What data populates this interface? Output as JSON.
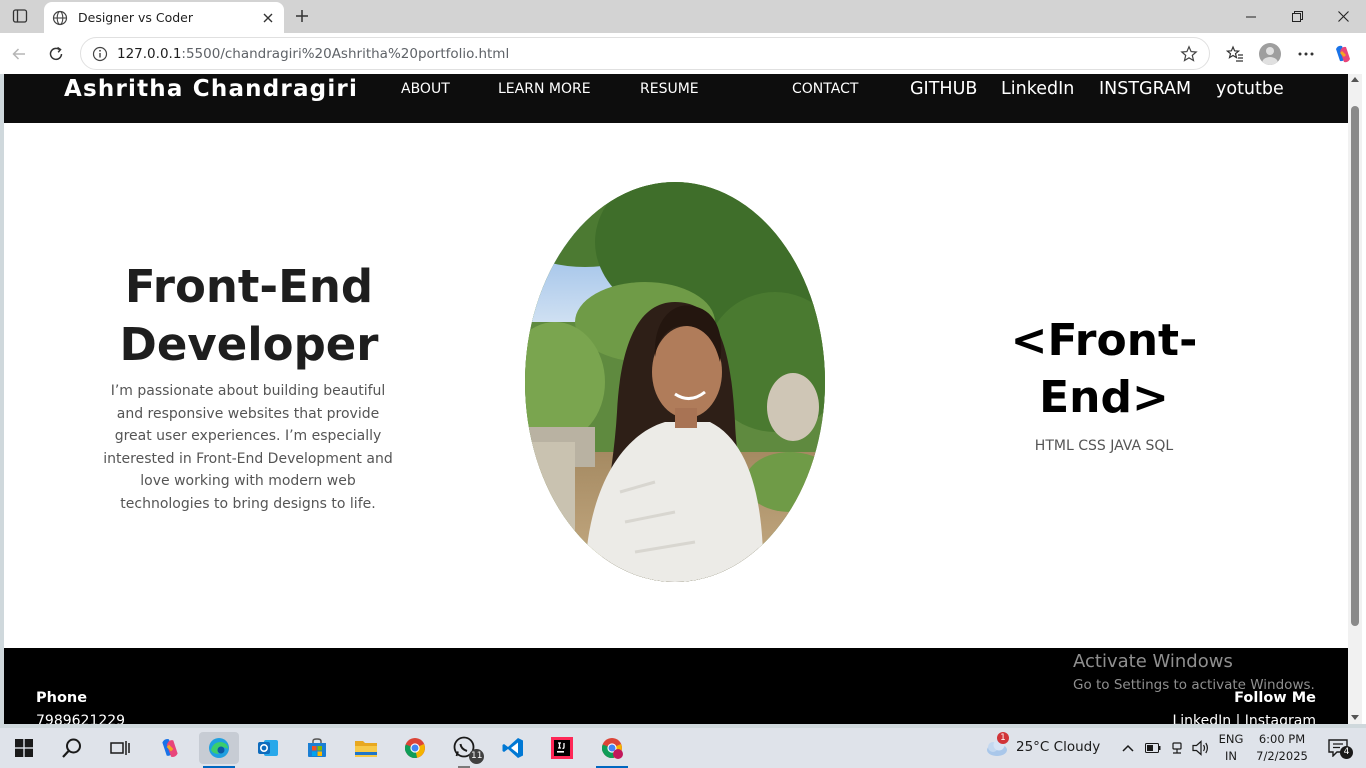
{
  "browser": {
    "tab_title": "Designer vs Coder",
    "url_host": "127.0.0.1",
    "url_path": ":5500/chandragiri%20Ashritha%20portfolio.html"
  },
  "site": {
    "brand": "Ashritha Chandragiri",
    "nav": [
      "ABOUT",
      "LEARN MORE",
      "RESUME",
      "CONTACT"
    ],
    "social_nav": [
      "GITHUB",
      "LinkedIn",
      "INSTGRAM",
      "yotutbe"
    ],
    "hero_title_line1": "Front-End",
    "hero_title_line2": "Developer",
    "hero_text": "I’m passionate about building beautiful and responsive websites that provide great user experiences. I’m especially interested in Front-End Development and love working with modern web technologies to bring designs to life.",
    "code_title_line1": "<Front-",
    "code_title_line2": "End>",
    "skills": "HTML CSS JAVA SQL"
  },
  "footer": {
    "phone_label": "Phone",
    "phone_number": "7989621229",
    "follow_label": "Follow Me",
    "social_links": "LinkedIn | Instagram"
  },
  "watermark": {
    "line1": "Activate Windows",
    "line2": "Go to Settings to activate Windows."
  },
  "taskbar": {
    "weather": "25°C  Cloudy",
    "weather_badge": "1",
    "whatsapp_badge": "11",
    "lang_top": "ENG",
    "lang_bottom": "IN",
    "time": "6:00 PM",
    "date": "7/2/2025",
    "notification_count": "4"
  }
}
